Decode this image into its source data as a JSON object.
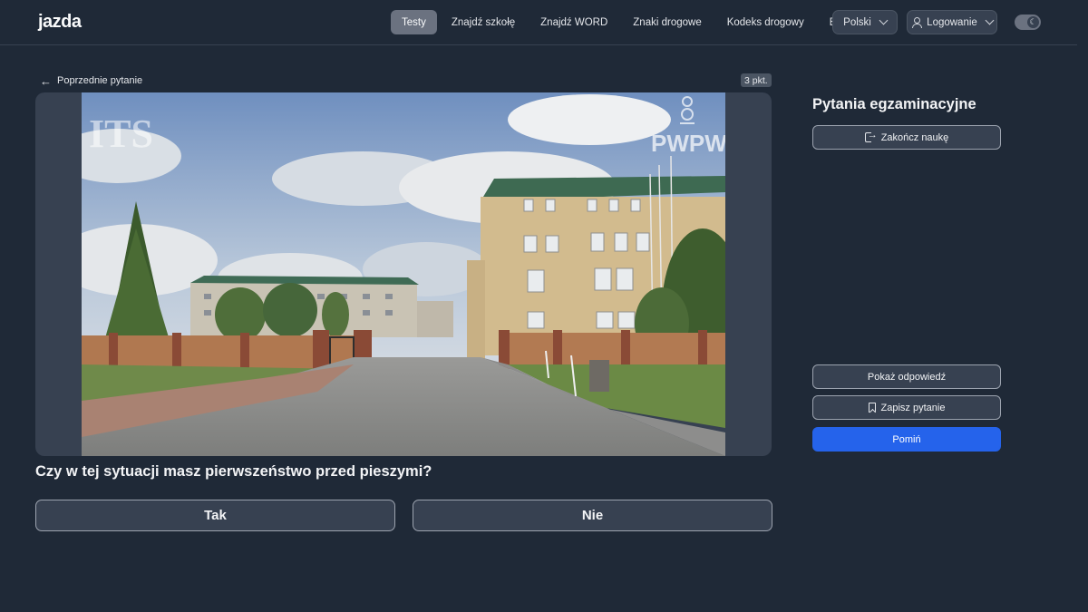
{
  "header": {
    "logo": "jazda",
    "nav": [
      {
        "label": "Testy",
        "active": true
      },
      {
        "label": "Znajdź szkołę",
        "active": false
      },
      {
        "label": "Znajdź WORD",
        "active": false
      },
      {
        "label": "Znaki drogowe",
        "active": false
      },
      {
        "label": "Kodeks drogowy",
        "active": false
      },
      {
        "label": "Blog",
        "active": false
      }
    ],
    "language": "Polski",
    "login": "Logowanie",
    "theme_toggle_icon": "moon-icon"
  },
  "main": {
    "prev_link": "Poprzednie pytanie",
    "points": "3 pkt.",
    "media": {
      "watermark_left": "ITS",
      "watermark_right": "PWPW"
    },
    "question": "Czy w tej sytuacji masz pierwszeństwo przed pieszymi?",
    "answers": [
      "Tak",
      "Nie"
    ]
  },
  "sidebar": {
    "title": "Pytania egzaminacyjne",
    "end_label": "Zakończ naukę",
    "show_answer_label": "Pokaż odpowiedź",
    "save_label": "Zapisz pytanie",
    "skip_label": "Pomiń"
  },
  "colors": {
    "background": "#1f2937",
    "accent": "#2563eb",
    "active_tab": "#6b7280"
  }
}
